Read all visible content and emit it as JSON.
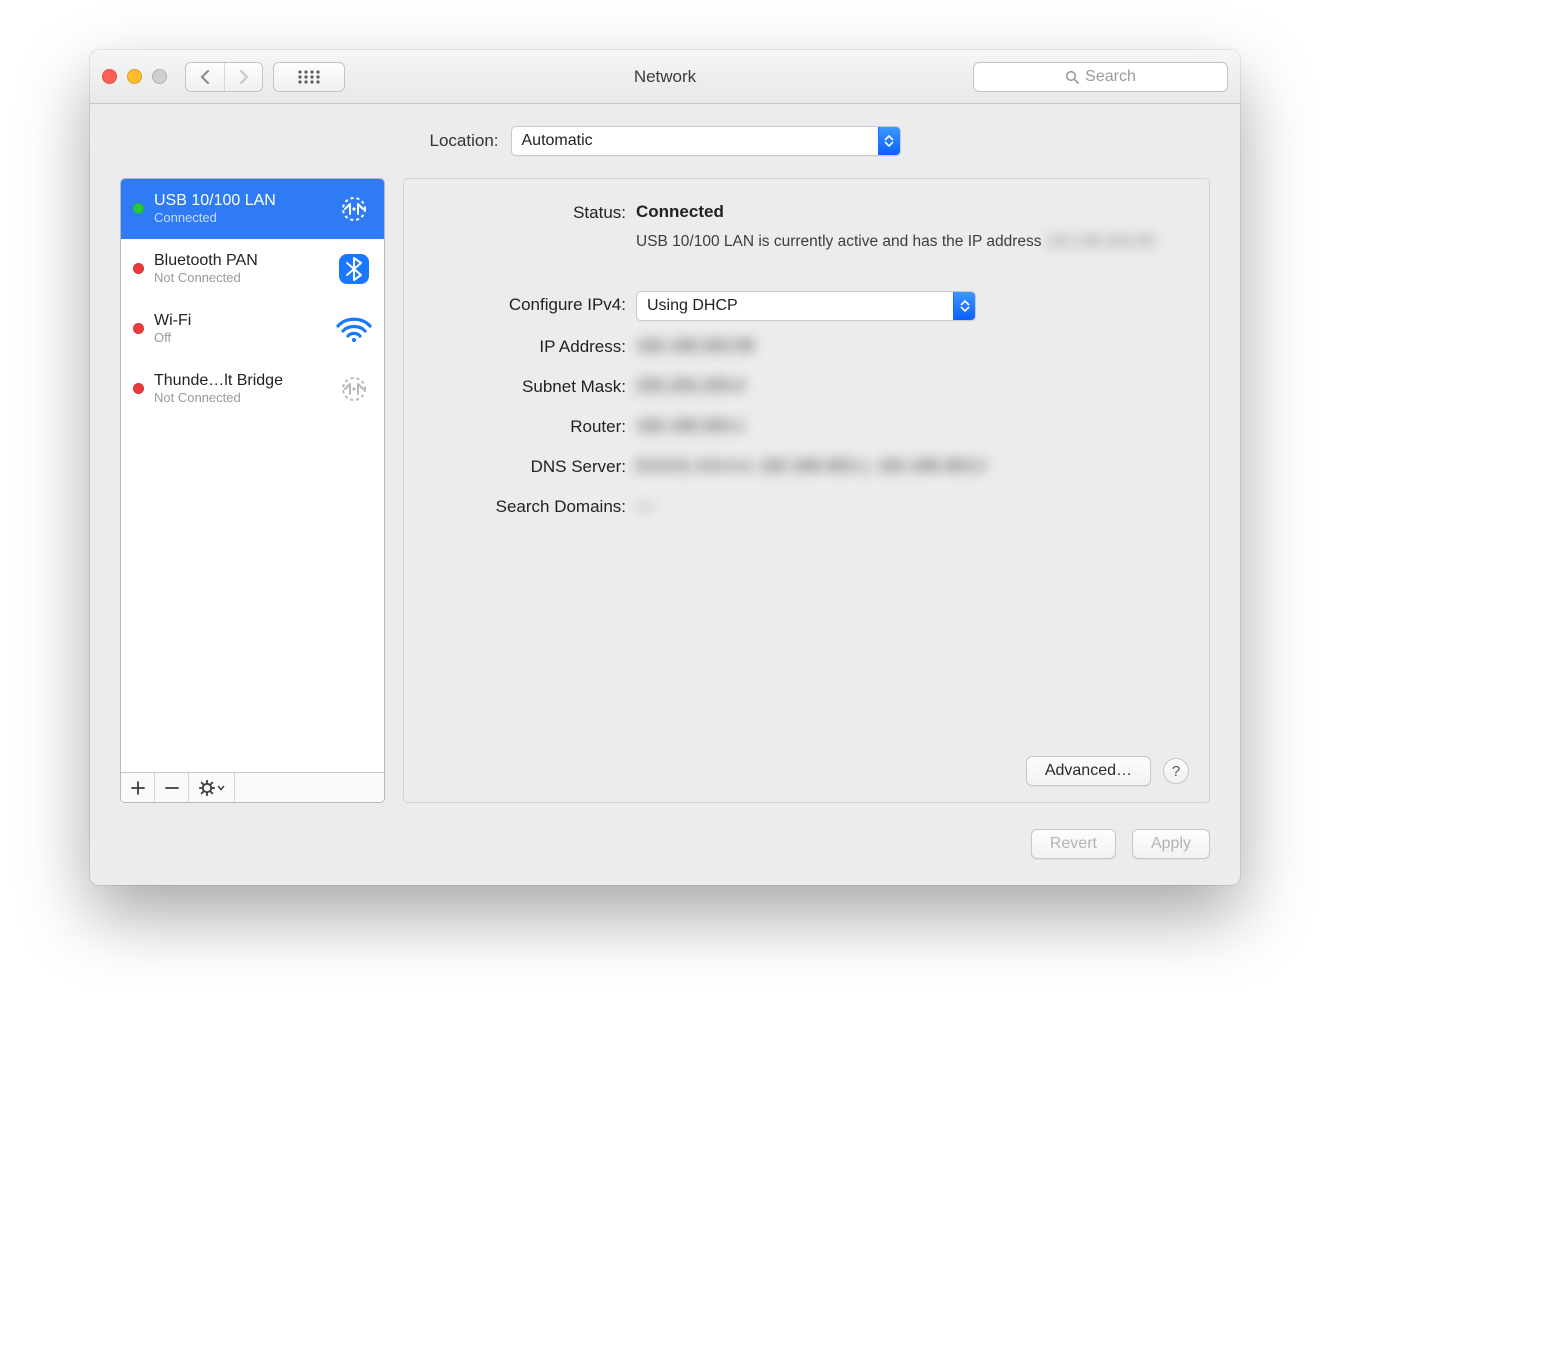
{
  "window": {
    "title": "Network",
    "search_placeholder": "Search"
  },
  "location": {
    "label": "Location:",
    "value": "Automatic"
  },
  "sidebar": {
    "items": [
      {
        "name": "USB 10/100 LAN",
        "status_label": "Connected",
        "status": "green",
        "icon": "ethernet",
        "selected": true
      },
      {
        "name": "Bluetooth PAN",
        "status_label": "Not Connected",
        "status": "red",
        "icon": "bluetooth",
        "selected": false
      },
      {
        "name": "Wi-Fi",
        "status_label": "Off",
        "status": "red",
        "icon": "wifi",
        "selected": false
      },
      {
        "name": "Thunde…lt Bridge",
        "status_label": "Not Connected",
        "status": "red",
        "icon": "ethernet-grey",
        "selected": false
      }
    ],
    "toolbar": {
      "add_label": "+",
      "remove_label": "−",
      "gear_label": "⚙︎"
    }
  },
  "detail": {
    "status_label": "Status:",
    "status_value": "Connected",
    "status_desc": "USB 10/100 LAN is currently active and has the IP address ",
    "status_desc_ip": "192.168.303.58.",
    "configure_label": "Configure IPv4:",
    "configure_value": "Using DHCP",
    "ip_label": "IP Address:",
    "ip_value": "192.168.303.58",
    "subnet_label": "Subnet Mask:",
    "subnet_value": "255.255.255.0",
    "router_label": "Router:",
    "router_value": "192.168.303.1",
    "dns_label": "DNS Server:",
    "dns_value": "8.8.8.8, 8.8.4.4, 192.168.303.1, 192.168.303.2",
    "search_label": "Search Domains:",
    "search_value": "—",
    "advanced_label": "Advanced…"
  },
  "footer": {
    "revert_label": "Revert",
    "apply_label": "Apply"
  }
}
